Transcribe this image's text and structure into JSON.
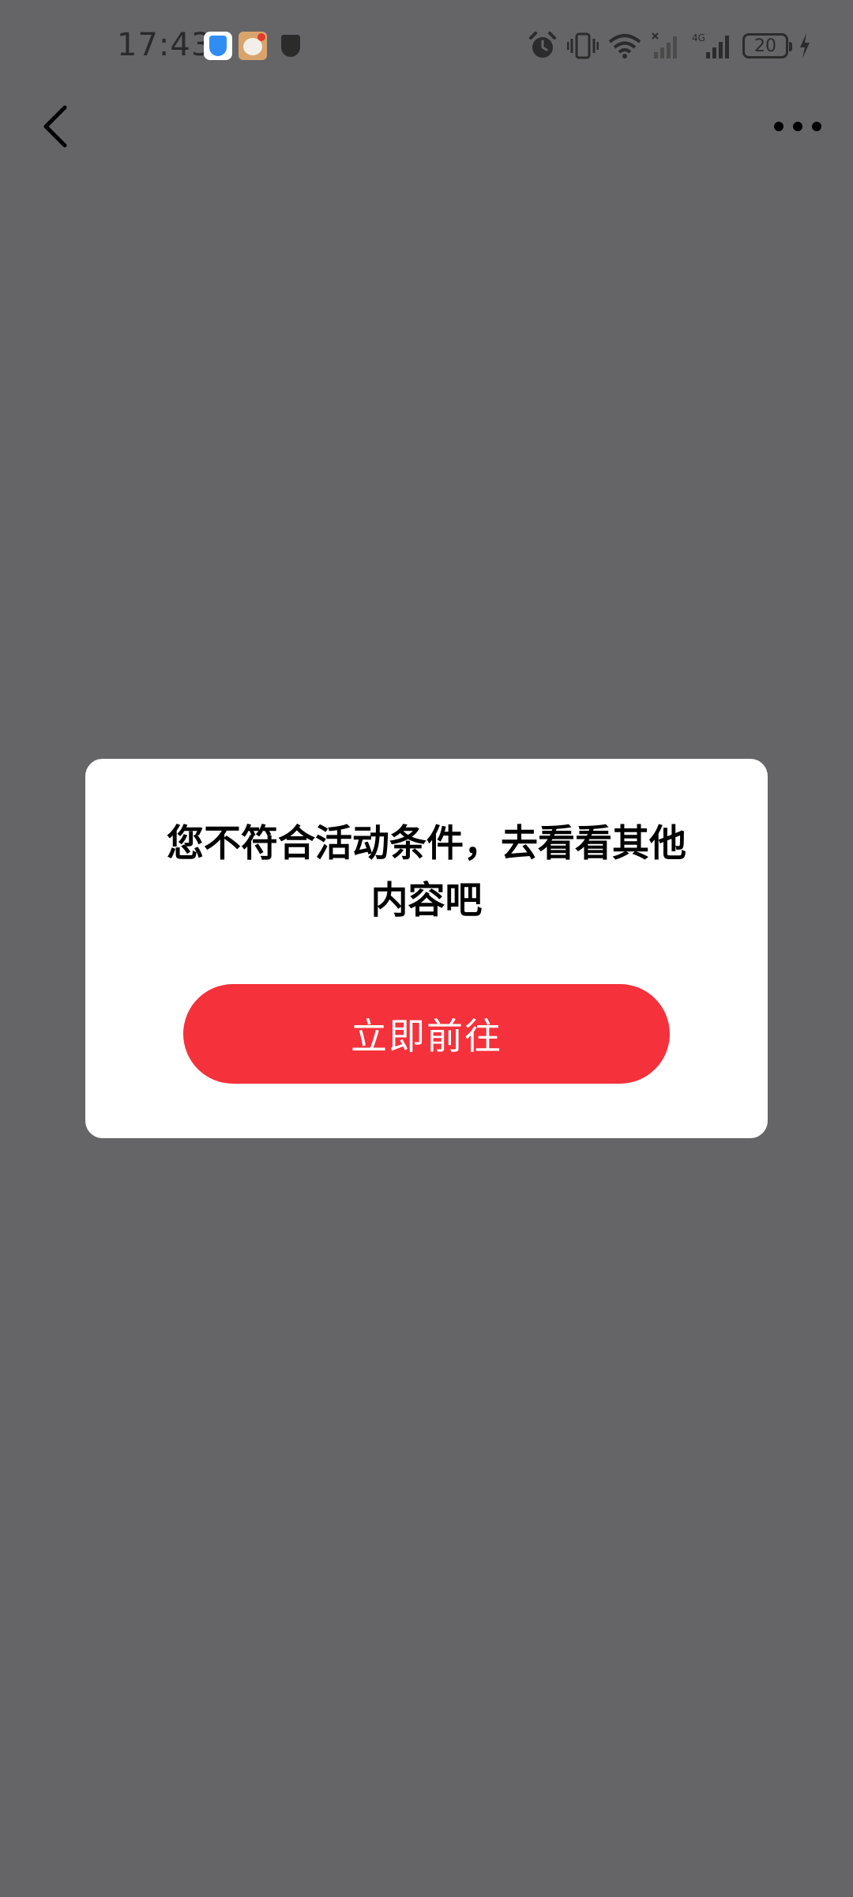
{
  "status_bar": {
    "time": "17:43",
    "battery_level": "20",
    "network": "4G",
    "icons": [
      "security-shield-icon",
      "app-mascot-icon",
      "shield-icon",
      "alarm-icon",
      "vibrate-icon",
      "wifi-icon",
      "signal-icon",
      "signal-icon",
      "battery-icon",
      "charging-icon"
    ]
  },
  "nav": {
    "back_icon": "chevron-left-icon",
    "more_icon": "more-dots-icon"
  },
  "dialog": {
    "message": "您不符合活动条件，去看看其他内容吧",
    "button_label": "立即前往"
  },
  "colors": {
    "overlay": "#656567",
    "dialog_bg": "#ffffff",
    "primary_button": "#f5313b"
  }
}
